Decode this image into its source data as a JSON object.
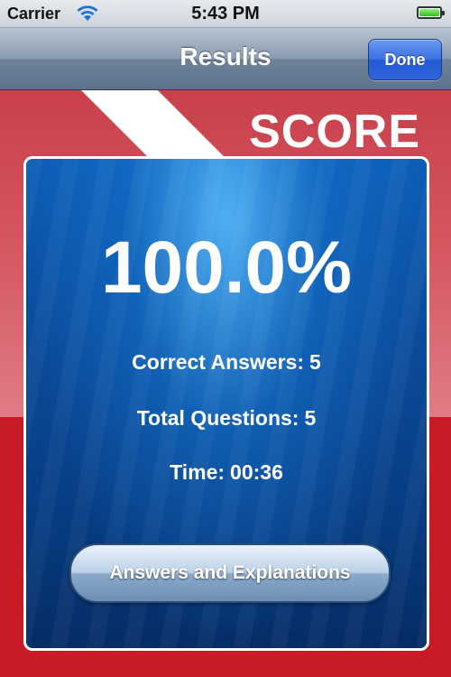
{
  "status_bar": {
    "carrier": "Carrier",
    "time": "5:43 PM",
    "battery_level": 1.0
  },
  "nav": {
    "title": "Results",
    "done_label": "Done"
  },
  "score": {
    "heading": "SCORE",
    "percent": "100.0%",
    "correct_label": "Correct Answers:",
    "correct_value": "5",
    "total_label": "Total Questions:",
    "total_value": "5",
    "time_label": "Time:",
    "time_value": "00:36",
    "explanations_label": "Answers and Explanations"
  },
  "colors": {
    "accent_red": "#c81b25",
    "panel_blue": "#0a4a99",
    "done_blue": "#2f66dc"
  }
}
